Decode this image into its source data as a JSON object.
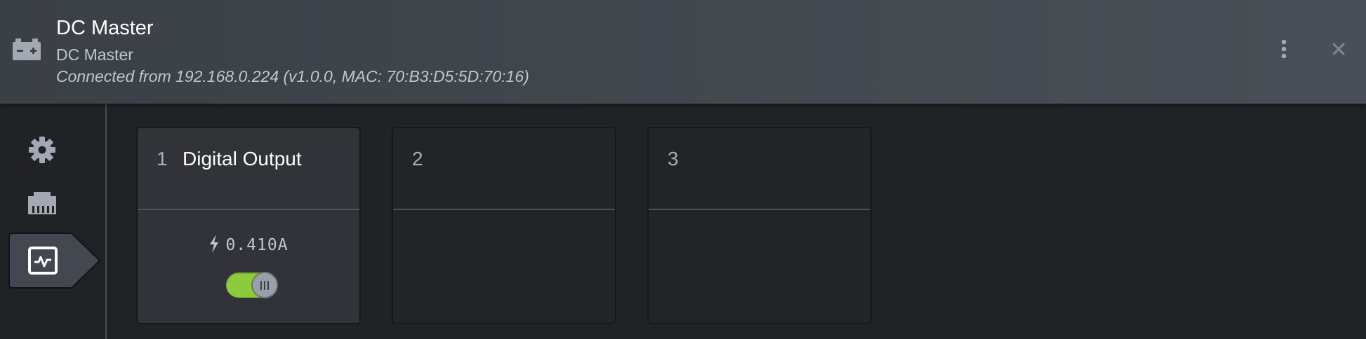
{
  "header": {
    "title": "DC Master",
    "subtitle": "DC Master",
    "connection": "Connected from 192.168.0.224 (v1.0.0, MAC: 70:B3:D5:5D:70:16)",
    "device_icon": "battery-icon",
    "menu_icon": "more-vert-icon",
    "close_icon": "close-icon"
  },
  "sidebar": {
    "items": [
      {
        "icon": "gear-icon",
        "active": false
      },
      {
        "icon": "ethernet-icon",
        "active": false
      },
      {
        "icon": "monitor-chart-icon",
        "active": true
      }
    ]
  },
  "channels": [
    {
      "number": "1",
      "name": "Digital Output",
      "current": "0.410A",
      "enabled": true
    },
    {
      "number": "2",
      "name": "",
      "current": "",
      "enabled": null
    },
    {
      "number": "3",
      "name": "",
      "current": "",
      "enabled": null
    }
  ],
  "colors": {
    "toggle_on": "#8ccc3a",
    "header_bg": "#3b3f46",
    "page_bg": "#202226",
    "icon": "#a3a9b2"
  }
}
